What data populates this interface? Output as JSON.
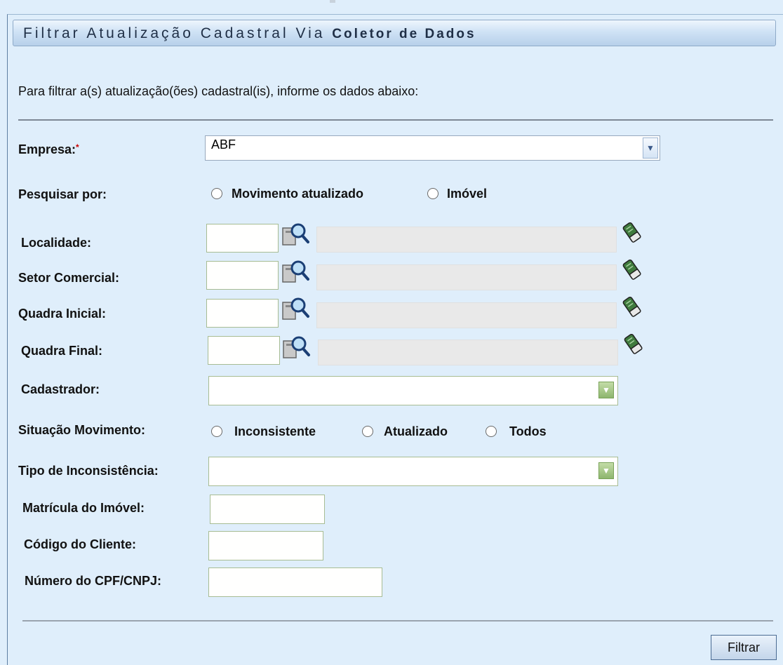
{
  "title": {
    "part1": "Filtrar Atualização Cadastral Via",
    "part2": "Coletor de Dados"
  },
  "instructions": "Para filtrar a(s) atualização(ões) cadastral(is), informe os dados abaixo:",
  "fields": {
    "empresa": {
      "label": "Empresa:",
      "required_mark": "*",
      "value": "ABF"
    },
    "pesquisar_por": {
      "label": "Pesquisar por:",
      "options": [
        "Movimento atualizado",
        "Imóvel"
      ]
    },
    "localidade": {
      "label": "Localidade:"
    },
    "setor_comercial": {
      "label": "Setor Comercial:"
    },
    "quadra_inicial": {
      "label": "Quadra Inicial:"
    },
    "quadra_final": {
      "label": "Quadra Final:"
    },
    "cadastrador": {
      "label": "Cadastrador:",
      "value": ""
    },
    "situacao_movimento": {
      "label": "Situação  Movimento:",
      "options": [
        "Inconsistente",
        "Atualizado",
        "Todos"
      ]
    },
    "tipo_inconsistencia": {
      "label": "Tipo de Inconsistência:",
      "value": ""
    },
    "matricula_imovel": {
      "label": "Matrícula do Imóvel:"
    },
    "codigo_cliente": {
      "label": "Código do Cliente:"
    },
    "cpf_cnpj": {
      "label": "Número do CPF/CNPJ:"
    }
  },
  "buttons": {
    "filtrar": "Filtrar"
  },
  "colors": {
    "background": "#dfeefb",
    "title_gradient_end": "#b7d0ea",
    "required": "#cc0000"
  }
}
